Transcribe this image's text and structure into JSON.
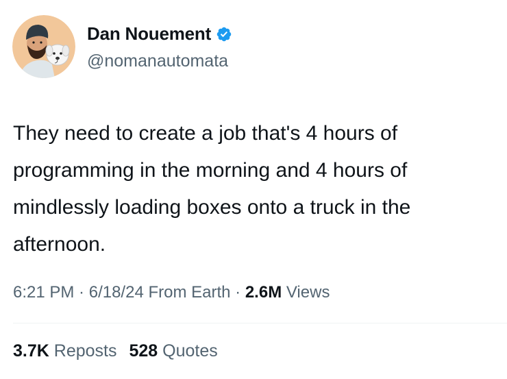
{
  "author": {
    "name": "Dan Nouement",
    "handle": "@nomanautomata",
    "verified_color": "#1d9bf0"
  },
  "tweet": {
    "lines": [
      "They need to create a job that's 4 hours of",
      "programming in the morning and 4 hours of",
      "mindlessly loading boxes onto a truck in the",
      "afternoon."
    ]
  },
  "meta": {
    "time": "6:21 PM",
    "sep1": " · ",
    "date": "6/18/24",
    "location": " From Earth",
    "sep2": " · ",
    "views_count": "2.6M",
    "views_label": " Views"
  },
  "stats": {
    "reposts_count": "3.7K",
    "reposts_label": " Reposts",
    "quotes_count": "528",
    "quotes_label": " Quotes"
  },
  "colors": {
    "text_primary": "#0f1419",
    "text_secondary": "#536471",
    "divider": "#eff3f4",
    "avatar_bg": "#f2c79a"
  },
  "icons": {
    "avatar": "avatar-icon",
    "verified": "verified-badge-icon"
  }
}
